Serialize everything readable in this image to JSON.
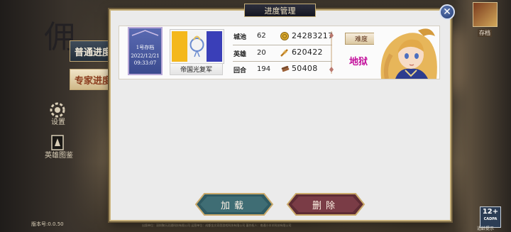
{
  "background": {
    "title_glyph": "佣",
    "left_menu": {
      "normal_progress_label": "普通进度",
      "expert_progress_label": "专家进度",
      "settings_label": "设置",
      "hero_gallery_label": "英雄图鉴"
    },
    "top_right_label": "存档",
    "version_text": "版本号:0.0.50",
    "footer_text": "出版单位：深圳聚乐灵通科技有限公司  运营单位：成都金文奇思游戏科技有限公司  著作权人：南通小羊羊科技有限公司",
    "age_rating": {
      "value": "12+",
      "sub": "CADPA",
      "label": "适龄提示"
    }
  },
  "dialog": {
    "title": "进度管理",
    "close_icon": "close-icon",
    "save": {
      "slot_label": "1号存档",
      "date": "2022/12/21",
      "time": "09:33:07",
      "faction_name": "帝国光复军",
      "stats": [
        {
          "label": "城池",
          "value": "62"
        },
        {
          "label": "英雄",
          "value": "20"
        },
        {
          "label": "回合",
          "value": "194"
        }
      ],
      "resources": [
        {
          "icon": "gold-coin-icon",
          "value": "24283217"
        },
        {
          "icon": "food-icon",
          "value": "620422"
        },
        {
          "icon": "wood-icon",
          "value": "50408"
        }
      ],
      "difficulty_label": "难度",
      "difficulty_value": "地狱",
      "difficulty_color": "#c3109c"
    },
    "buttons": {
      "load_label": "加载",
      "delete_label": "删除"
    }
  },
  "colors": {
    "dialog_border": "#c7b07a",
    "load_button": "#3f6d74",
    "delete_button": "#7a3c46"
  }
}
